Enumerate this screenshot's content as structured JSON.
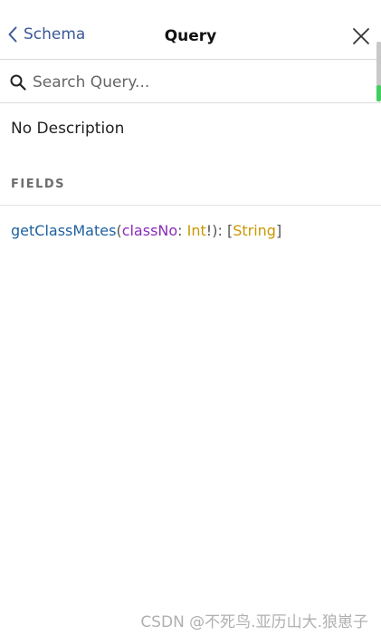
{
  "header": {
    "back_label": "Schema",
    "title": "Query"
  },
  "search": {
    "placeholder": "Search Query..."
  },
  "doc": {
    "description": "No Description",
    "fields_section_title": "FIELDS",
    "fields": [
      {
        "name": "getClassMates",
        "open_paren": "(",
        "arg_name": "classNo",
        "colon": ": ",
        "arg_type": "Int",
        "non_null": "!",
        "close_paren": "): ",
        "list_open": "[",
        "return_type": "String",
        "list_close": "]"
      }
    ]
  },
  "watermark": {
    "text": "CSDN @不死鸟.亚历山大.狼崽子"
  },
  "colors": {
    "link_blue": "#3b5998",
    "field_name": "#1f61a0",
    "arg_name": "#8b2bb9",
    "type_name": "#ca9800",
    "scroll_indicator": "#3ecf60"
  },
  "icons": {
    "back": "chevron-left-icon",
    "close": "close-icon",
    "search": "search-icon"
  }
}
